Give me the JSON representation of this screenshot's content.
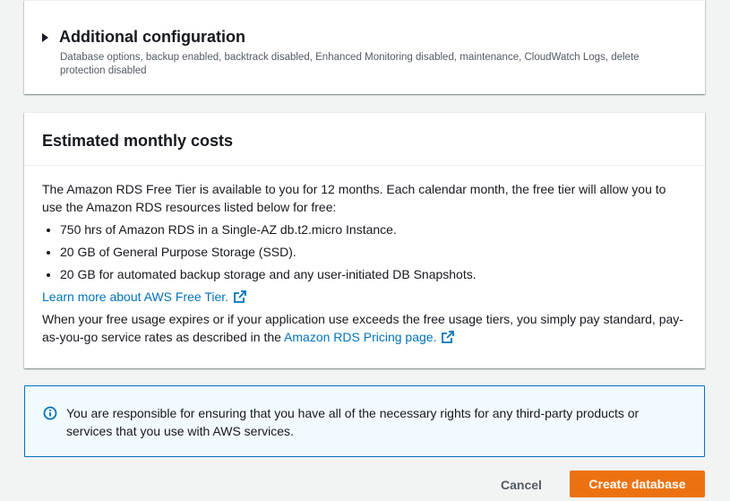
{
  "additional_configuration": {
    "title": "Additional configuration",
    "description": "Database options, backup enabled, backtrack disabled, Enhanced Monitoring disabled, maintenance, CloudWatch Logs, delete protection disabled"
  },
  "estimated_costs": {
    "title": "Estimated monthly costs",
    "intro": "The Amazon RDS Free Tier is available to you for 12 months. Each calendar month, the free tier will allow you to use the Amazon RDS resources listed below for free:",
    "items": [
      "750 hrs of Amazon RDS in a Single-AZ db.t2.micro Instance.",
      "20 GB of General Purpose Storage (SSD).",
      "20 GB for automated backup storage and any user-initiated DB Snapshots."
    ],
    "learn_more_link": "Learn more about AWS Free Tier.",
    "expiry_text": "When your free usage expires or if your application use exceeds the free usage tiers, you simply pay standard, pay-as-you-go service rates as described in the",
    "pricing_link": "Amazon RDS Pricing page."
  },
  "info_alert": {
    "icon": "info-icon",
    "text": "You are responsible for ensuring that you have all of the necessary rights for any third-party products or services that you use with AWS services."
  },
  "actions": {
    "cancel_label": "Cancel",
    "create_label": "Create database"
  },
  "colors": {
    "primary_button": "#ec7211",
    "link": "#0073bb",
    "alert_border": "#0073bb",
    "alert_bg": "#f1faff"
  }
}
